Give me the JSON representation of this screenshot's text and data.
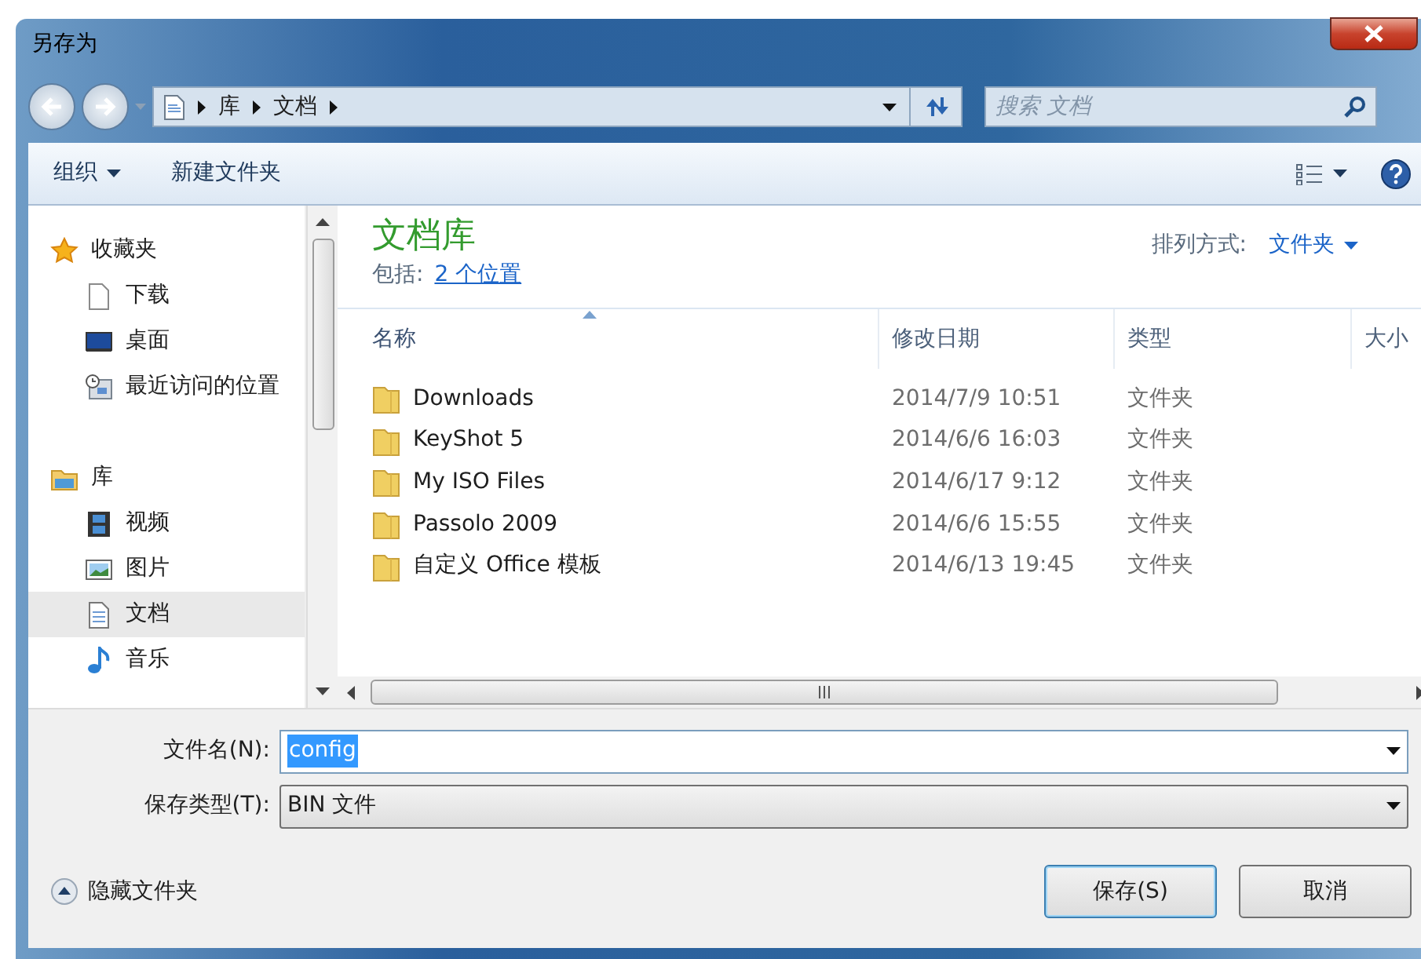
{
  "window": {
    "title": "另存为"
  },
  "address": {
    "path": [
      "库",
      "文档"
    ]
  },
  "search": {
    "placeholder": "搜索 文档"
  },
  "toolbar": {
    "buttons": [
      "组织",
      "新建文件夹"
    ]
  },
  "nav": {
    "groups": [
      {
        "label": "收藏夹",
        "kind": "star",
        "selected": false,
        "children": [
          {
            "label": "下载",
            "kind": "page",
            "selected": false
          },
          {
            "label": "桌面",
            "kind": "desktop",
            "selected": false
          },
          {
            "label": "最近访问的位置",
            "kind": "recent",
            "selected": false
          }
        ]
      },
      {
        "label": "库",
        "kind": "library",
        "selected": false,
        "children": [
          {
            "label": "视频",
            "kind": "video",
            "selected": false
          },
          {
            "label": "图片",
            "kind": "image",
            "selected": false
          },
          {
            "label": "文档",
            "kind": "doc",
            "selected": true
          },
          {
            "label": "音乐",
            "kind": "music",
            "selected": false
          }
        ]
      }
    ]
  },
  "library": {
    "title": "文档库",
    "includes_label": "包括:",
    "includes_link": "2 个位置",
    "arrange_label": "排列方式:",
    "arrange_value": "文件夹"
  },
  "table": {
    "columns": [
      {
        "label": "名称",
        "sorted": true
      },
      {
        "label": "修改日期",
        "sorted": false
      },
      {
        "label": "类型",
        "sorted": false
      },
      {
        "label": "大小",
        "sorted": false
      }
    ],
    "rows": [
      {
        "name": "Downloads",
        "modified": "2014/7/9 10:51",
        "type": "文件夹"
      },
      {
        "name": "KeyShot 5",
        "modified": "2014/6/6 16:03",
        "type": "文件夹"
      },
      {
        "name": "My ISO Files",
        "modified": "2014/6/17 9:12",
        "type": "文件夹"
      },
      {
        "name": "Passolo 2009",
        "modified": "2014/6/6 15:55",
        "type": "文件夹"
      },
      {
        "name": "自定义 Office 模板",
        "modified": "2014/6/13 19:45",
        "type": "文件夹"
      }
    ]
  },
  "filename": {
    "label": "文件名(N):",
    "value": "config"
  },
  "filetype": {
    "label": "保存类型(T):",
    "value": "BIN 文件"
  },
  "hide_folders": "隐藏文件夹",
  "buttons": [
    {
      "label": "保存(S)",
      "default": true
    },
    {
      "label": "取消",
      "default": false
    }
  ]
}
